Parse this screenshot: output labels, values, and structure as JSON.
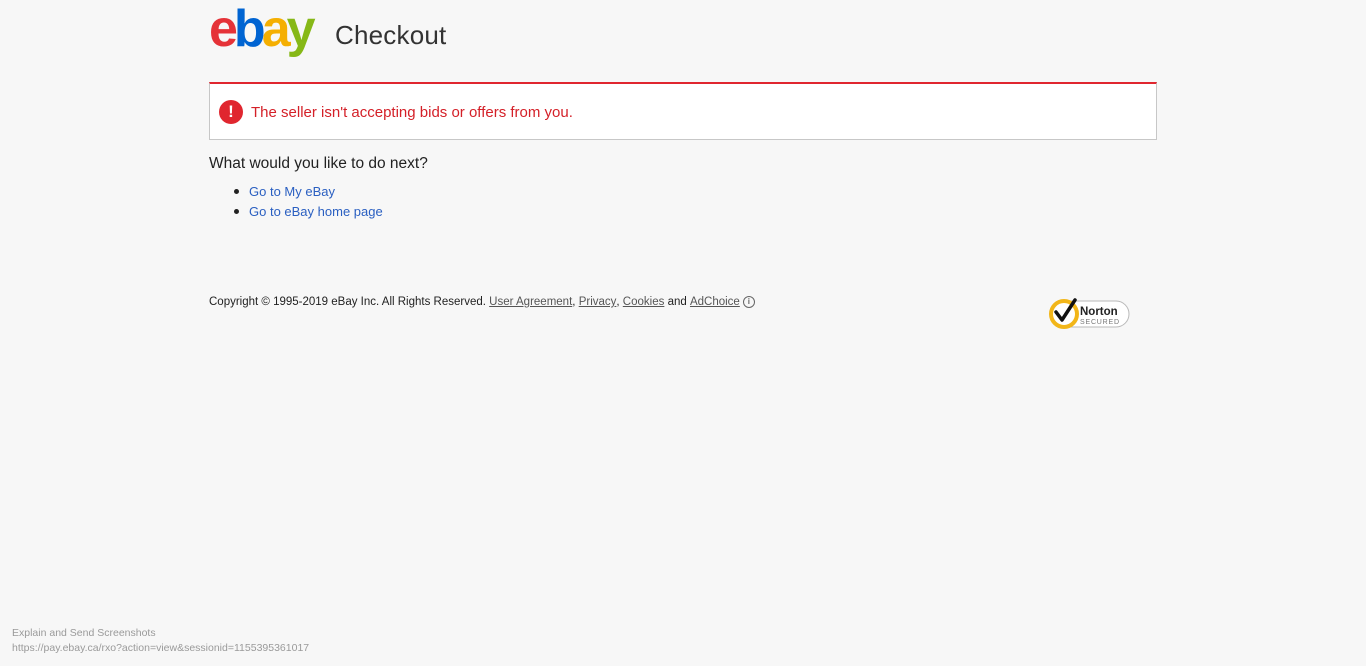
{
  "header": {
    "logo_text": "ebay",
    "title": "Checkout"
  },
  "alert": {
    "icon": "exclamation-circle-icon",
    "icon_glyph": "!",
    "message": "The seller isn't accepting bids or offers from you.",
    "color": "#e0262f"
  },
  "next": {
    "heading": "What would you like to do next?",
    "links": [
      {
        "label": "Go to My eBay"
      },
      {
        "label": "Go to eBay home page"
      }
    ]
  },
  "footer": {
    "copyright": "Copyright © 1995-2019 eBay Inc. All Rights Reserved.",
    "links": {
      "user_agreement": "User Agreement",
      "privacy": "Privacy",
      "cookies": "Cookies",
      "adchoice": "AdChoice"
    },
    "separator": ",",
    "and_word": "and"
  },
  "badge": {
    "name": "Norton",
    "sub": "SECURED"
  },
  "statusbar": {
    "line1": "Explain and Send Screenshots",
    "line2": "https://pay.ebay.ca/rxo?action=view&sessionid=1155395361017"
  },
  "colors": {
    "ebay_red": "#e53238",
    "ebay_blue": "#0064d2",
    "ebay_yellow": "#f5af02",
    "ebay_green": "#86b817",
    "link": "#2a5fc1"
  }
}
